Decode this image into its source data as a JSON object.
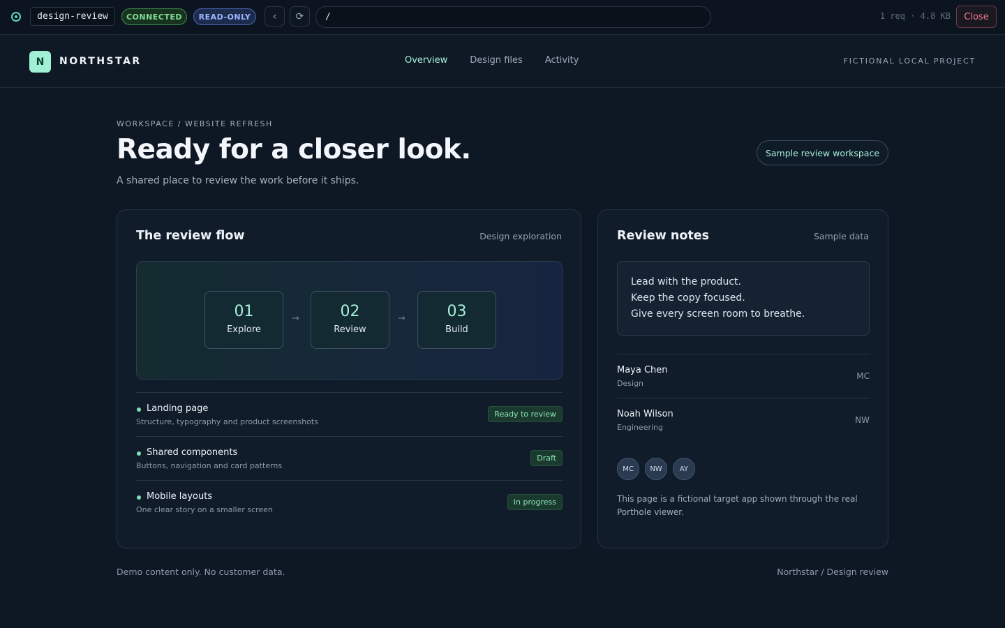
{
  "viewer": {
    "project": "design-review",
    "status_connected": "CONNECTED",
    "status_readonly": "READ-ONLY",
    "back_icon": "‹",
    "reload_icon": "⟳",
    "url": "/",
    "stats": "1 req · 4.8 KB",
    "close_label": "Close"
  },
  "header": {
    "brand_initial": "N",
    "brand_name": "NORTHSTAR",
    "nav": [
      {
        "label": "Overview",
        "active": true
      },
      {
        "label": "Design files",
        "active": false
      },
      {
        "label": "Activity",
        "active": false
      }
    ],
    "tag": "FICTIONAL LOCAL PROJECT"
  },
  "intro": {
    "breadcrumb": "WORKSPACE / WEBSITE REFRESH",
    "title": "Ready for a closer look.",
    "subtitle": "A shared place to review the work before it ships.",
    "workspace_label": "Sample review workspace"
  },
  "flow_card": {
    "title": "The review flow",
    "meta": "Design exploration",
    "steps": [
      {
        "num": "01",
        "label": "Explore"
      },
      {
        "num": "02",
        "label": "Review"
      },
      {
        "num": "03",
        "label": "Build"
      }
    ],
    "arrow": "→",
    "items": [
      {
        "title": "Landing page",
        "desc": "Structure, typography and product screenshots",
        "status": "Ready to review"
      },
      {
        "title": "Shared components",
        "desc": "Buttons, navigation and card patterns",
        "status": "Draft"
      },
      {
        "title": "Mobile layouts",
        "desc": "One clear story on a smaller screen",
        "status": "In progress"
      }
    ]
  },
  "notes_card": {
    "title": "Review notes",
    "meta": "Sample data",
    "notes": [
      "Lead with the product.",
      "Keep the copy focused.",
      "Give every screen room to breathe."
    ],
    "people": [
      {
        "name": "Maya Chen",
        "role": "Design",
        "initials": "MC"
      },
      {
        "name": "Noah Wilson",
        "role": "Engineering",
        "initials": "NW"
      }
    ],
    "avatars": [
      "MC",
      "NW",
      "AY"
    ],
    "footnote": "This page is a fictional target app shown through the real Porthole viewer."
  },
  "footer": {
    "left": "Demo content only. No customer data.",
    "right": "Northstar / Design review"
  },
  "colors": {
    "background": "#0e1724",
    "accent": "#a6f0d8",
    "connected": "#7fdc95",
    "readonly": "#9db8ff",
    "close": "#f07b92"
  }
}
